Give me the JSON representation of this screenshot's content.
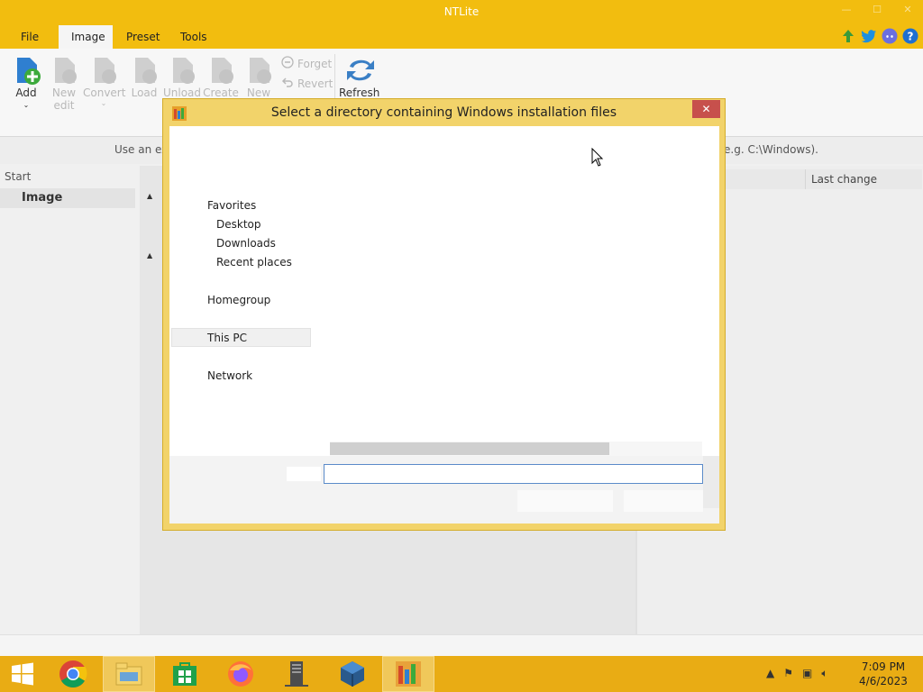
{
  "window": {
    "title": "NTLite",
    "controls": {
      "minimize": "—",
      "maximize": "☐",
      "close": "✕"
    }
  },
  "menu": {
    "tabs": [
      {
        "label": "File"
      },
      {
        "label": "Image"
      },
      {
        "label": "Preset"
      },
      {
        "label": "Tools"
      }
    ],
    "active_tab": "Image"
  },
  "ribbon": {
    "add": "Add",
    "new_edit_1": "New",
    "new_edit_2": "edit",
    "convert": "Convert",
    "load": "Load",
    "unload": "Unload",
    "create": "Create",
    "new": "New",
    "forget": "Forget",
    "revert": "Revert",
    "refresh": "Refresh"
  },
  "infobar": {
    "left_text": "Use an exi",
    "right_text": "e.g. C:\\Windows)."
  },
  "leftpane": {
    "start_label": "Start",
    "image_label": "Image"
  },
  "rightpane": {
    "last_change_header": "Last change"
  },
  "dialog": {
    "title": "Select a directory containing Windows installation files",
    "close_symbol": "✕",
    "nav": {
      "favorites": "Favorites",
      "desktop": "Desktop",
      "downloads": "Downloads",
      "recent_places": "Recent places",
      "homegroup": "Homegroup",
      "this_pc": "This PC",
      "network": "Network"
    },
    "filename_value": ""
  },
  "taskbar": {
    "time": "7:09 PM",
    "date": "4/6/2023"
  },
  "colors": {
    "accent": "#f2bd0f",
    "taskbar": "#e9ac14",
    "dialog_frame": "#f2d36a",
    "close_red": "#c7504c"
  }
}
